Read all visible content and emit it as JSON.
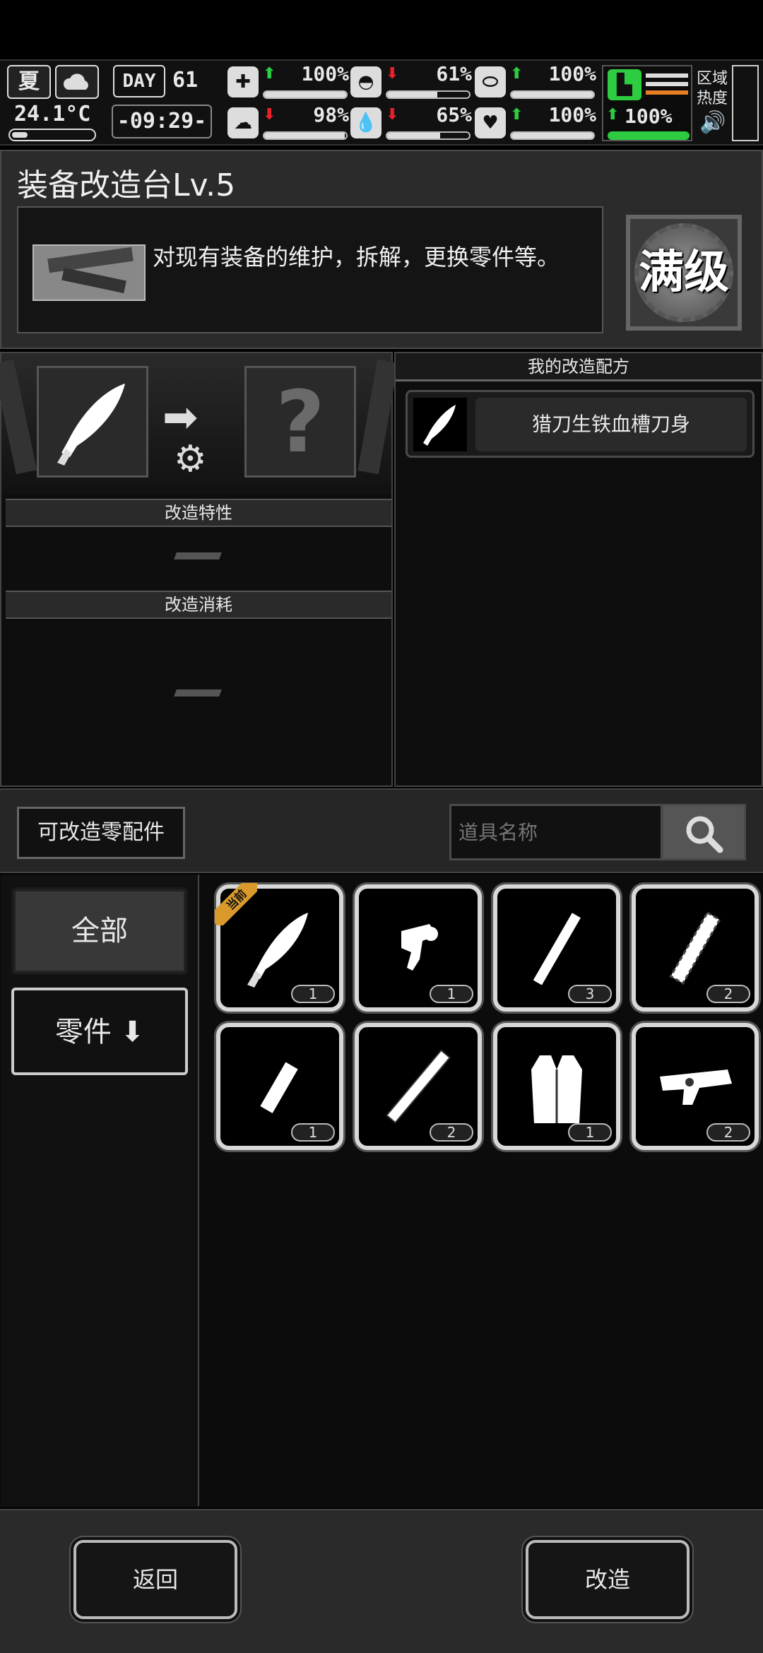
{
  "status": {
    "season": "夏",
    "temperature": "24.1°C",
    "day_label": "DAY",
    "day_number": "61",
    "time": "-09:29-",
    "stats": [
      {
        "icon": "medkit-icon",
        "arrow": "up",
        "value": "100%",
        "level": 1.0
      },
      {
        "icon": "stomach-icon",
        "arrow": "down",
        "value": "61%",
        "level": 0.61
      },
      {
        "icon": "pill-icon",
        "arrow": "up",
        "value": "100%",
        "level": 1.0
      },
      {
        "icon": "brain-icon",
        "arrow": "down",
        "value": "98%",
        "level": 0.98
      },
      {
        "icon": "water-drop-icon",
        "arrow": "down",
        "value": "65%",
        "level": 0.65
      },
      {
        "icon": "heart-icon",
        "arrow": "up",
        "value": "100%",
        "level": 1.0
      }
    ],
    "stamina": {
      "arrow": "up",
      "value": "100%",
      "level": 1.0
    },
    "zone_label": "区域热度"
  },
  "station": {
    "title": "装备改造台Lv.5",
    "description": "对现有装备的维护，拆解，更换零件等。",
    "max_label": "满级"
  },
  "modify": {
    "traits_header": "改造特性",
    "traits_value": "",
    "cost_header": "改造消耗",
    "cost_value": ""
  },
  "recipes": {
    "header": "我的改造配方",
    "items": [
      {
        "label": "猎刀生铁血槽刀身",
        "icon": "blade-icon"
      }
    ]
  },
  "parts_bar": {
    "button_label": "可改造零配件",
    "search_placeholder": "道具名称"
  },
  "categories": [
    {
      "label": "全部"
    },
    {
      "label": "零件 ⬇"
    }
  ],
  "items": [
    {
      "icon": "knife-blade-icon",
      "count": "1",
      "current_tag": "当前"
    },
    {
      "icon": "trigger-icon",
      "count": "1"
    },
    {
      "icon": "rod-icon",
      "count": "3"
    },
    {
      "icon": "wrapped-handle-icon",
      "count": "2"
    },
    {
      "icon": "short-tube-icon",
      "count": "1"
    },
    {
      "icon": "carved-handle-icon",
      "count": "2"
    },
    {
      "icon": "vest-icon",
      "count": "1"
    },
    {
      "icon": "gun-receiver-icon",
      "count": "2"
    }
  ],
  "footer": {
    "back_label": "返回",
    "modify_label": "改造"
  }
}
